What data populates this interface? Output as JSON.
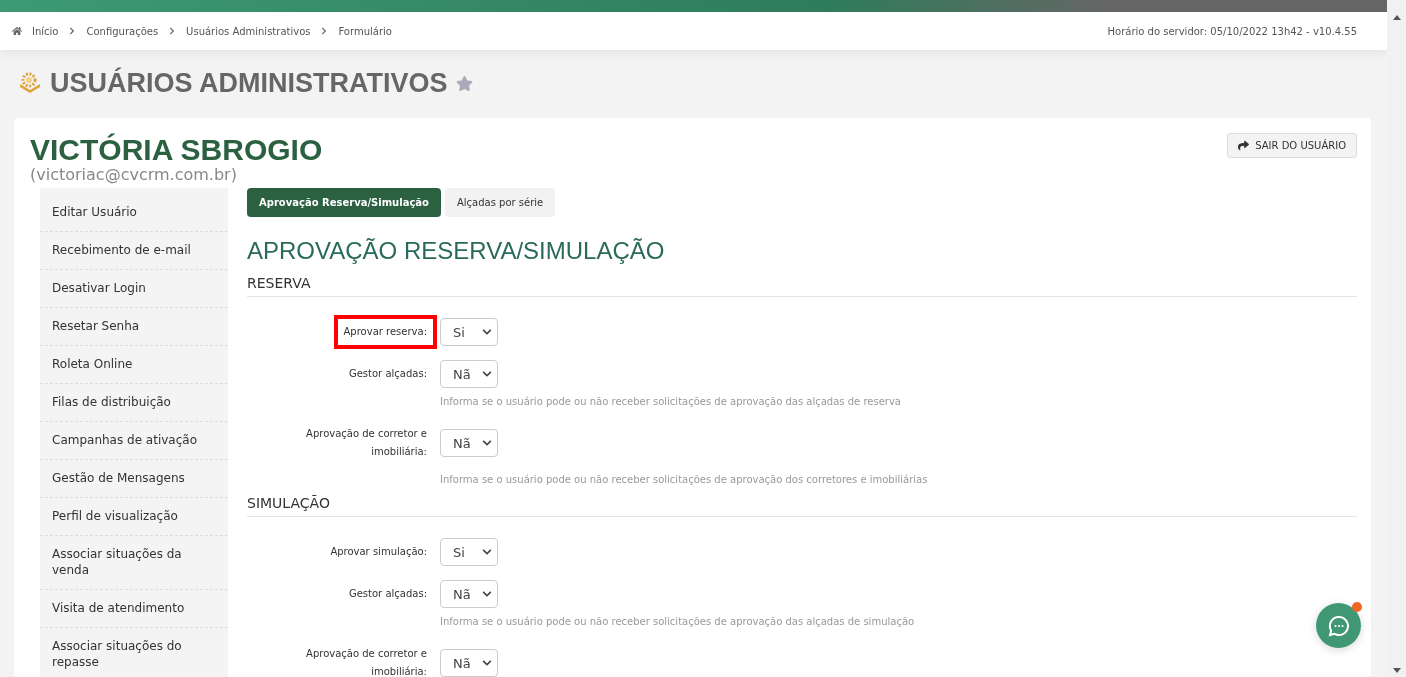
{
  "breadcrumb": [
    {
      "label": "Início"
    },
    {
      "label": "Configurações"
    },
    {
      "label": "Usuários Administrativos"
    },
    {
      "label": "Formulário"
    }
  ],
  "server_info": "Horário do servidor: 05/10/2022 13h42 - v10.4.55",
  "page_title": "USUÁRIOS ADMINISTRATIVOS",
  "favorite": false,
  "user": {
    "name": "VICTÓRIA SBROGIO",
    "email": "(victoriac@cvcrm.com.br)"
  },
  "logout_button": "SAIR DO USUÁRIO",
  "sidebar": {
    "items": [
      {
        "label": "Editar Usuário"
      },
      {
        "label": "Recebimento de e-mail"
      },
      {
        "label": "Desativar Login"
      },
      {
        "label": "Resetar Senha"
      },
      {
        "label": "Roleta Online"
      },
      {
        "label": "Filas de distribuição"
      },
      {
        "label": "Campanhas de ativação"
      },
      {
        "label": "Gestão de Mensagens"
      },
      {
        "label": "Perfil de visualização"
      },
      {
        "label": "Associar situações da venda"
      },
      {
        "label": "Visita de atendimento"
      },
      {
        "label": "Associar situações do repasse"
      }
    ]
  },
  "tabs": [
    {
      "label": "Aprovação Reserva/Simulação",
      "selected": true
    },
    {
      "label": "Alçadas por série",
      "selected": false
    }
  ],
  "heading": "APROVAÇÃO RESERVA/SIMULAÇÃO",
  "sections": [
    {
      "title": "RESERVA",
      "fields": [
        {
          "label": "Aprovar reserva:",
          "value": "Si",
          "highlighted": true
        },
        {
          "label": "Gestor alçadas:",
          "value": "Nã",
          "highlighted": false,
          "help": "Informa se o usuário pode ou não receber solicitações de aprovação das alçadas de reserva"
        },
        {
          "label": "Aprovação de corretor e imobiliária:",
          "value": "Nã",
          "highlighted": false,
          "help": "Informa se o usuário pode ou não receber solicitações de aprovação dos corretores e imobiliárias"
        }
      ]
    },
    {
      "title": "SIMULAÇÃO",
      "fields": [
        {
          "label": "Aprovar simulação:",
          "value": "Si",
          "highlighted": false
        },
        {
          "label": "Gestor alçadas:",
          "value": "Nã",
          "highlighted": false,
          "help": "Informa se o usuário pode ou não receber solicitações de aprovação das alçadas de simulação"
        },
        {
          "label": "Aprovação de corretor e imobiliária:",
          "value": "Nã",
          "highlighted": false
        }
      ]
    }
  ],
  "chat": {
    "unread": true
  }
}
